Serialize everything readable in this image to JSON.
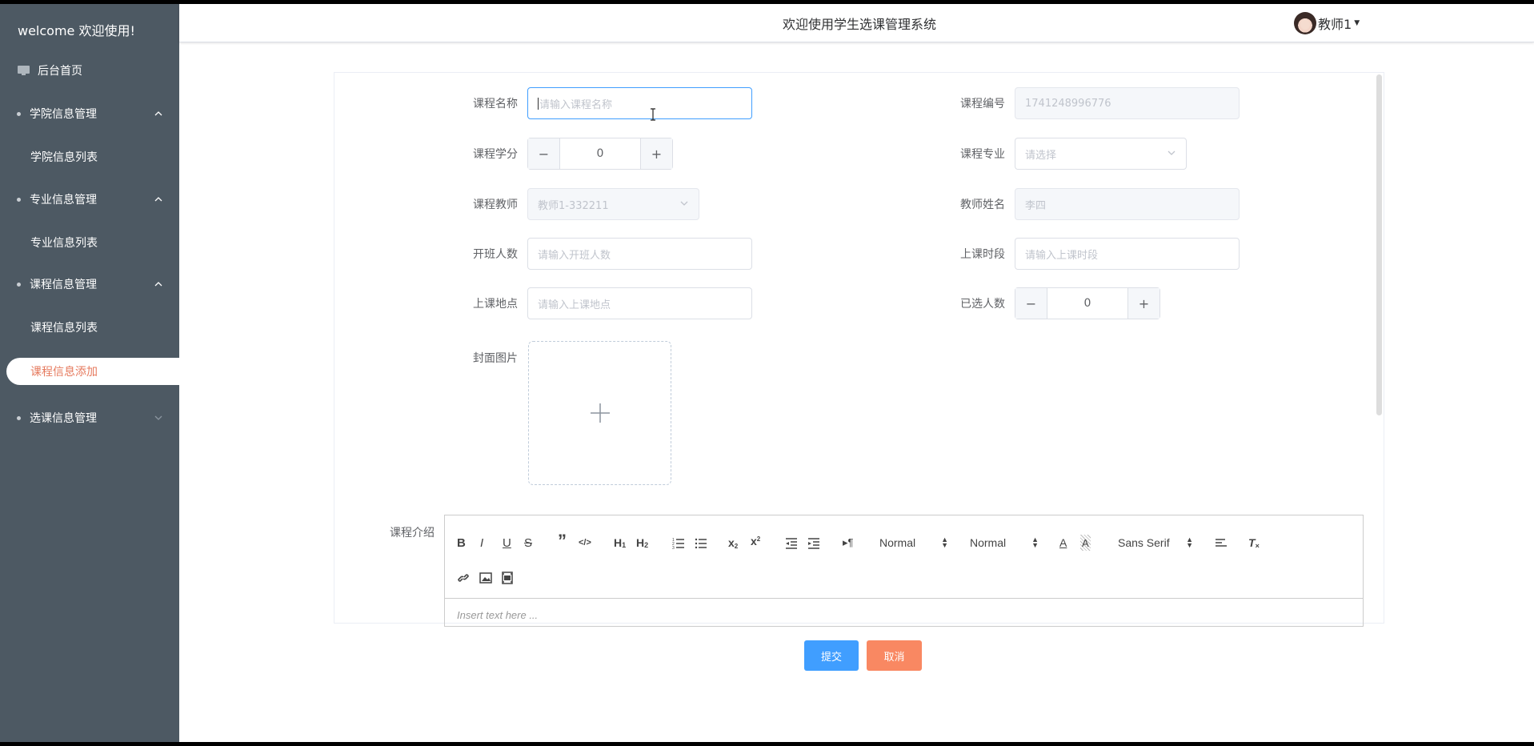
{
  "sidebar": {
    "title": "welcome 欢迎使用!",
    "home": "后台首页",
    "menus": [
      {
        "label": "学院信息管理",
        "sub": "学院信息列表"
      },
      {
        "label": "专业信息管理",
        "sub": "专业信息列表"
      },
      {
        "label": "课程信息管理",
        "sub": "课程信息列表",
        "sub2": "课程信息添加"
      },
      {
        "label": "选课信息管理"
      }
    ]
  },
  "header": {
    "title": "欢迎使用学生选课管理系统",
    "user": "教师1"
  },
  "form": {
    "course_name_label": "课程名称",
    "course_name_placeholder": "请输入课程名称",
    "course_no_label": "课程编号",
    "course_no_value": "1741248996776",
    "credit_label": "课程学分",
    "credit_value": "0",
    "major_label": "课程专业",
    "major_placeholder": "请选择",
    "teacher_label": "课程教师",
    "teacher_value": "教师1-332211",
    "teacher_name_label": "教师姓名",
    "teacher_name_value": "李四",
    "capacity_label": "开班人数",
    "capacity_placeholder": "请输入开班人数",
    "time_label": "上课时段",
    "time_placeholder": "请输入上课时段",
    "location_label": "上课地点",
    "location_placeholder": "请输入上课地点",
    "selected_label": "已选人数",
    "selected_value": "0",
    "cover_label": "封面图片",
    "intro_label": "课程介绍"
  },
  "editor": {
    "header_select": "Normal",
    "size_select": "Normal",
    "font_select": "Sans Serif",
    "placeholder": "Insert text here ..."
  },
  "buttons": {
    "submit": "提交",
    "cancel": "取消"
  },
  "colors": {
    "sidebar_bg": "#4d5963",
    "active_text": "#e67a5e",
    "primary": "#409eff",
    "cancel": "#f98862"
  }
}
